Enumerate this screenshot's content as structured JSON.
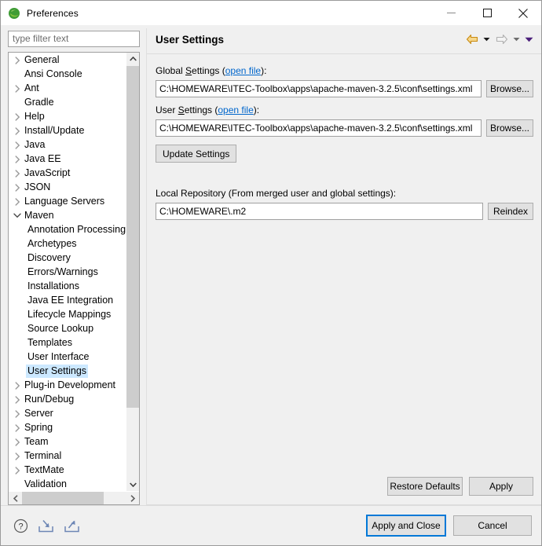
{
  "window": {
    "title": "Preferences",
    "icon": "eclipse-icon",
    "minimize_label": "Minimize",
    "maximize_label": "Maximize",
    "close_label": "Close"
  },
  "filter": {
    "placeholder": "type filter text",
    "value": ""
  },
  "tree": {
    "items": [
      {
        "label": "General",
        "level": 0,
        "expandable": true,
        "expanded": false,
        "selected": false
      },
      {
        "label": "Ansi Console",
        "level": 0,
        "expandable": false,
        "expanded": false,
        "selected": false
      },
      {
        "label": "Ant",
        "level": 0,
        "expandable": true,
        "expanded": false,
        "selected": false
      },
      {
        "label": "Gradle",
        "level": 0,
        "expandable": false,
        "expanded": false,
        "selected": false
      },
      {
        "label": "Help",
        "level": 0,
        "expandable": true,
        "expanded": false,
        "selected": false
      },
      {
        "label": "Install/Update",
        "level": 0,
        "expandable": true,
        "expanded": false,
        "selected": false
      },
      {
        "label": "Java",
        "level": 0,
        "expandable": true,
        "expanded": false,
        "selected": false
      },
      {
        "label": "Java EE",
        "level": 0,
        "expandable": true,
        "expanded": false,
        "selected": false
      },
      {
        "label": "JavaScript",
        "level": 0,
        "expandable": true,
        "expanded": false,
        "selected": false
      },
      {
        "label": "JSON",
        "level": 0,
        "expandable": true,
        "expanded": false,
        "selected": false
      },
      {
        "label": "Language Servers",
        "level": 0,
        "expandable": true,
        "expanded": false,
        "selected": false
      },
      {
        "label": "Maven",
        "level": 0,
        "expandable": true,
        "expanded": true,
        "selected": false
      },
      {
        "label": "Annotation Processing",
        "level": 1,
        "expandable": false,
        "expanded": false,
        "selected": false
      },
      {
        "label": "Archetypes",
        "level": 1,
        "expandable": false,
        "expanded": false,
        "selected": false
      },
      {
        "label": "Discovery",
        "level": 1,
        "expandable": false,
        "expanded": false,
        "selected": false
      },
      {
        "label": "Errors/Warnings",
        "level": 1,
        "expandable": false,
        "expanded": false,
        "selected": false
      },
      {
        "label": "Installations",
        "level": 1,
        "expandable": false,
        "expanded": false,
        "selected": false
      },
      {
        "label": "Java EE Integration",
        "level": 1,
        "expandable": false,
        "expanded": false,
        "selected": false
      },
      {
        "label": "Lifecycle Mappings",
        "level": 1,
        "expandable": false,
        "expanded": false,
        "selected": false
      },
      {
        "label": "Source Lookup",
        "level": 1,
        "expandable": false,
        "expanded": false,
        "selected": false
      },
      {
        "label": "Templates",
        "level": 1,
        "expandable": false,
        "expanded": false,
        "selected": false
      },
      {
        "label": "User Interface",
        "level": 1,
        "expandable": false,
        "expanded": false,
        "selected": false
      },
      {
        "label": "User Settings",
        "level": 1,
        "expandable": false,
        "expanded": false,
        "selected": true
      },
      {
        "label": "Plug-in Development",
        "level": 0,
        "expandable": true,
        "expanded": false,
        "selected": false
      },
      {
        "label": "Run/Debug",
        "level": 0,
        "expandable": true,
        "expanded": false,
        "selected": false
      },
      {
        "label": "Server",
        "level": 0,
        "expandable": true,
        "expanded": false,
        "selected": false
      },
      {
        "label": "Spring",
        "level": 0,
        "expandable": true,
        "expanded": false,
        "selected": false
      },
      {
        "label": "Team",
        "level": 0,
        "expandable": true,
        "expanded": false,
        "selected": false
      },
      {
        "label": "Terminal",
        "level": 0,
        "expandable": true,
        "expanded": false,
        "selected": false
      },
      {
        "label": "TextMate",
        "level": 0,
        "expandable": true,
        "expanded": false,
        "selected": false
      },
      {
        "label": "Validation",
        "level": 0,
        "expandable": false,
        "expanded": false,
        "selected": false
      }
    ],
    "scroll": {
      "vertical_thumb_pct": 83,
      "horizontal_thumb_pct": 79
    }
  },
  "page": {
    "title": "User Settings",
    "nav": {
      "back_label": "Back",
      "back_menu_label": "Back history",
      "forward_label": "Forward",
      "forward_menu_label": "Forward history",
      "view_menu_label": "View menu"
    },
    "global_settings": {
      "label_pre": "Global ",
      "label_mnemonic": "S",
      "label_post": "ettings (",
      "link": "open file",
      "label_end": "):",
      "value": "C:\\HOMEWARE\\ITEC-Toolbox\\apps\\apache-maven-3.2.5\\conf\\settings.xml",
      "browse_label": "Browse..."
    },
    "user_settings": {
      "label_pre": "User ",
      "label_mnemonic": "S",
      "label_post": "ettings (",
      "link": "open file",
      "label_end": "):",
      "value": "C:\\HOMEWARE\\ITEC-Toolbox\\apps\\apache-maven-3.2.5\\conf\\settings.xml",
      "browse_label": "Browse..."
    },
    "update_settings_label": "Update Settings",
    "local_repository": {
      "label": "Local Repository (From merged user and global settings):",
      "value": "C:\\HOMEWARE\\.m2",
      "reindex_label": "Reindex"
    },
    "restore_defaults_label": "Restore Defaults",
    "apply_label": "Apply"
  },
  "footer": {
    "help_icon": "help-icon",
    "import_icon": "import-icon",
    "export_icon": "export-icon",
    "apply_and_close_label": "Apply and Close",
    "cancel_label": "Cancel"
  },
  "colors": {
    "selection": "#cce8ff",
    "link": "#0066cc",
    "focus_ring": "#0078d7",
    "back_arrow": "#e8a317",
    "forward_arrow": "#b9b9b9",
    "menu_arrow": "#4b1f7a",
    "eclipse_green": "#3f9c35"
  }
}
